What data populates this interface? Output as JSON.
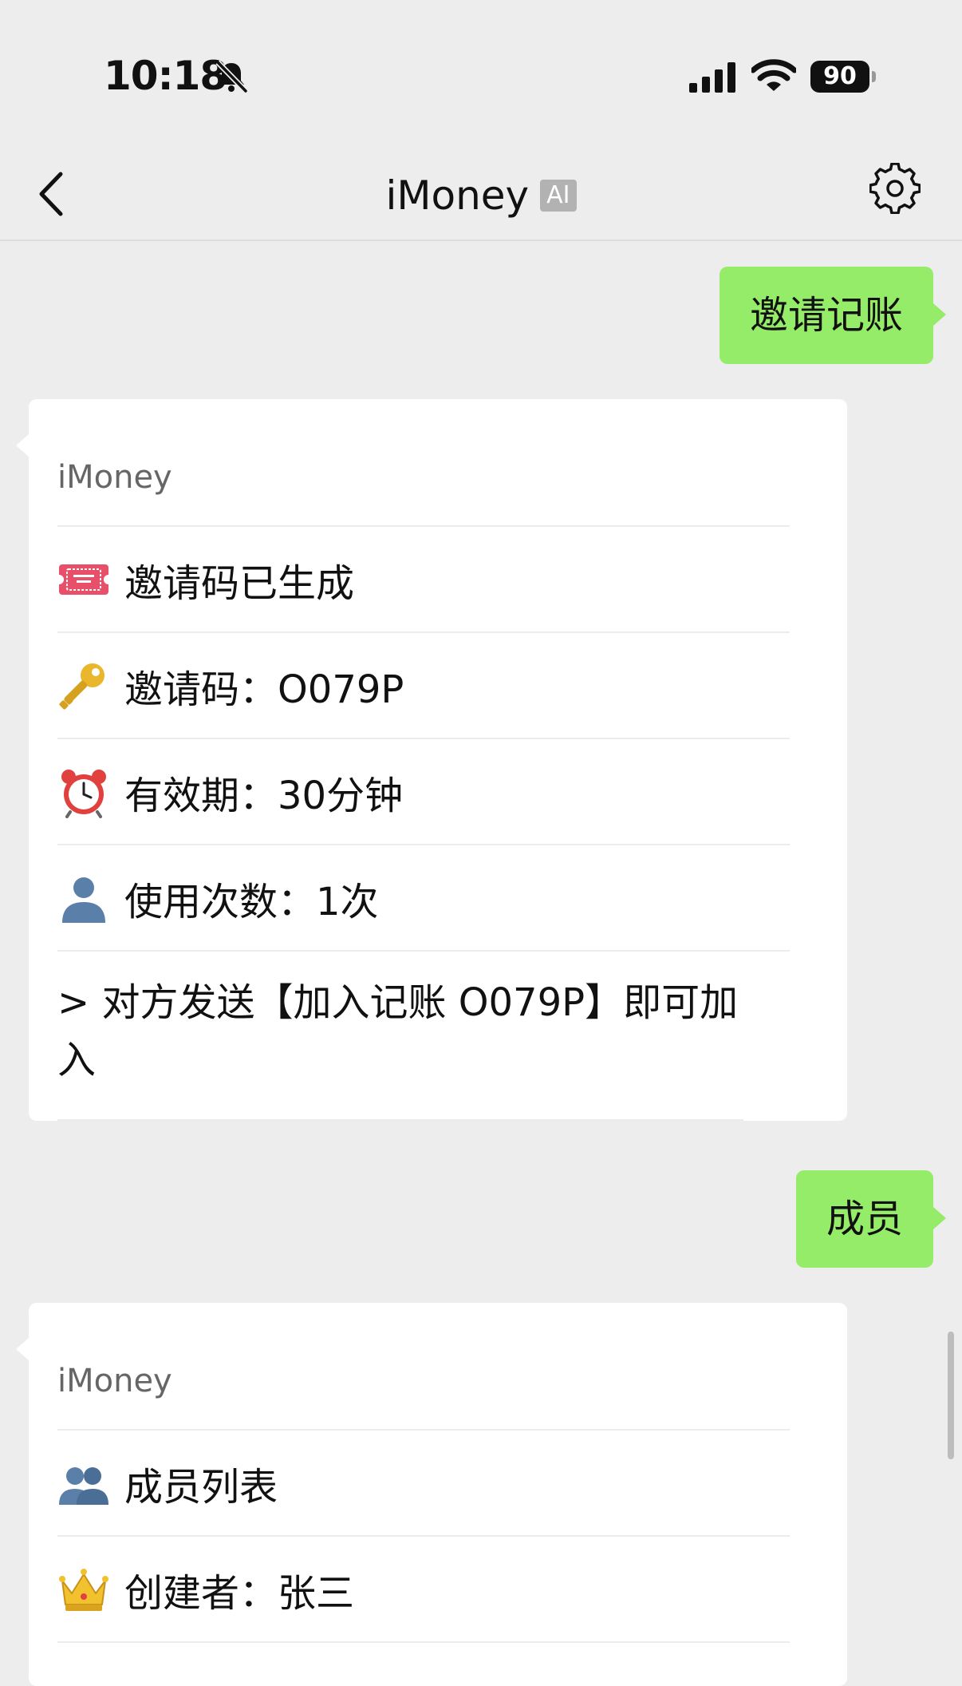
{
  "status_bar": {
    "time": "10:18",
    "battery": "90",
    "icons": [
      "bell-slash-icon",
      "cellular-signal-icon",
      "wifi-icon",
      "battery-icon"
    ]
  },
  "nav": {
    "title": "iMoney",
    "badge": "AI",
    "icons": [
      "back-chevron-icon",
      "gear-icon"
    ]
  },
  "messages": {
    "user_1": "邀请记账",
    "card_1": {
      "sender": "iMoney",
      "rows": [
        {
          "icon": "ticket-icon",
          "text": "邀请码已生成"
        },
        {
          "icon": "key-icon",
          "text": "邀请码：O079P"
        },
        {
          "icon": "alarm-clock-icon",
          "text": "有效期：30分钟"
        },
        {
          "icon": "person-silhouette-icon",
          "text": "使用次数：1次"
        }
      ],
      "note": "> 对方发送【加入记账 O079P】即可加入"
    },
    "user_2": "成员",
    "card_2": {
      "sender": "iMoney",
      "rows": [
        {
          "icon": "people-silhouette-icon",
          "text": "成员列表"
        },
        {
          "icon": "crown-icon",
          "text": "创建者：张三"
        }
      ]
    }
  },
  "colors": {
    "background": "#ededed",
    "user_bubble": "#95ec69",
    "card": "#ffffff",
    "ai_badge": "#b2b2b2"
  }
}
